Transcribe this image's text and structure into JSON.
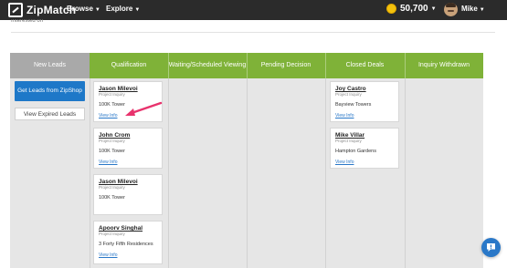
{
  "nav": {
    "logo": "ZipMatch",
    "browse": "Browse",
    "explore": "Explore",
    "coins": "50,700",
    "user": "Mike"
  },
  "header_cutoff": "Interested on",
  "columns": [
    "New Leads",
    "Qualification",
    "Waiting/Scheduled Viewing",
    "Pending Decision",
    "Closed Deals",
    "Inquiry Withdrawn"
  ],
  "new_leads": {
    "get_leads": "Get Leads from ZipShop",
    "view_expired": "View Expired Leads"
  },
  "qualification": [
    {
      "name": "Jason Milevoi",
      "type": "Project Inquiry",
      "property": "100K Tower",
      "link": "View Info"
    },
    {
      "name": "John Crom",
      "type": "Project Inquiry",
      "property": "100K Tower",
      "link": "View Info"
    },
    {
      "name": "Jason Milevoi",
      "type": "Project Inquiry",
      "property": "100K Tower",
      "link": "View Info"
    },
    {
      "name": "Apoorv Singhal",
      "type": "Project Inquiry",
      "property": "3 Forty Fifth Residences",
      "link": "View Info"
    }
  ],
  "closed_deals": [
    {
      "name": "Joy Castro",
      "type": "Project Inquiry",
      "property": "Bayview Towers",
      "link": "View Info"
    },
    {
      "name": "Mike Villar",
      "type": "Project Inquiry",
      "property": "Hampton Gardens",
      "link": "View Info"
    }
  ],
  "colors": {
    "nav_bg": "#2b2b2b",
    "column_green": "#7fb238",
    "column_gray": "#a9a9a9",
    "primary_blue": "#1e78c8",
    "annotation_pink": "#e8336d"
  },
  "icons": [
    "zipmatch-logo-icon",
    "coin-icon",
    "avatar",
    "annotation-arrow",
    "chat-icon"
  ]
}
